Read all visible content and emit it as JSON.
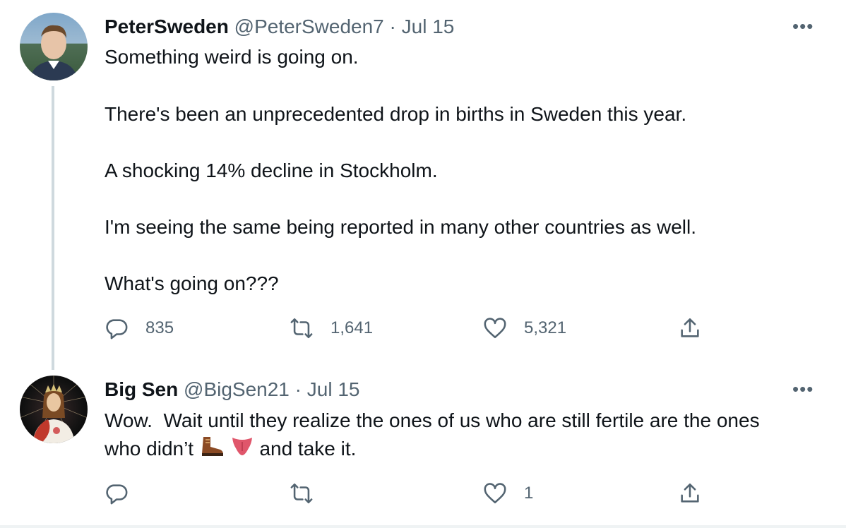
{
  "tweets": [
    {
      "author_name": "PeterSweden",
      "handle": "@PeterSweden7",
      "separator": "·",
      "date": "Jul 15",
      "more": "•••",
      "lines": [
        "Something weird is going on.",
        "There's been an unprecedented drop in births in Sweden this year.",
        "A shocking 14% decline in Stockholm.",
        "I'm seeing the same being reported in many other countries as well.",
        "What's going on???"
      ],
      "actions": {
        "reply": {
          "icon": "reply-icon",
          "count": "835"
        },
        "retweet": {
          "icon": "retweet-icon",
          "count": "1,641"
        },
        "like": {
          "icon": "heart-icon",
          "count": "5,321"
        },
        "share": {
          "icon": "share-icon"
        }
      }
    },
    {
      "author_name": "Big Sen",
      "handle": "@BigSen21",
      "separator": "·",
      "date": "Jul 15",
      "more": "•••",
      "line1": "Wow.  Wait until they realize the ones of us who are still fertile are the ones",
      "line2_start": "who didn’t",
      "emoji_1": "boot-emoji",
      "emoji_2": "tongue-emoji",
      "line2_end": "and take it.",
      "actions": {
        "reply": {
          "icon": "reply-icon",
          "count": ""
        },
        "retweet": {
          "icon": "retweet-icon",
          "count": ""
        },
        "like": {
          "icon": "heart-icon",
          "count": "1"
        },
        "share": {
          "icon": "share-icon"
        }
      }
    }
  ],
  "colors": {
    "text": "#0f1419",
    "secondary": "#536471",
    "thread_line": "#cfd9de"
  }
}
